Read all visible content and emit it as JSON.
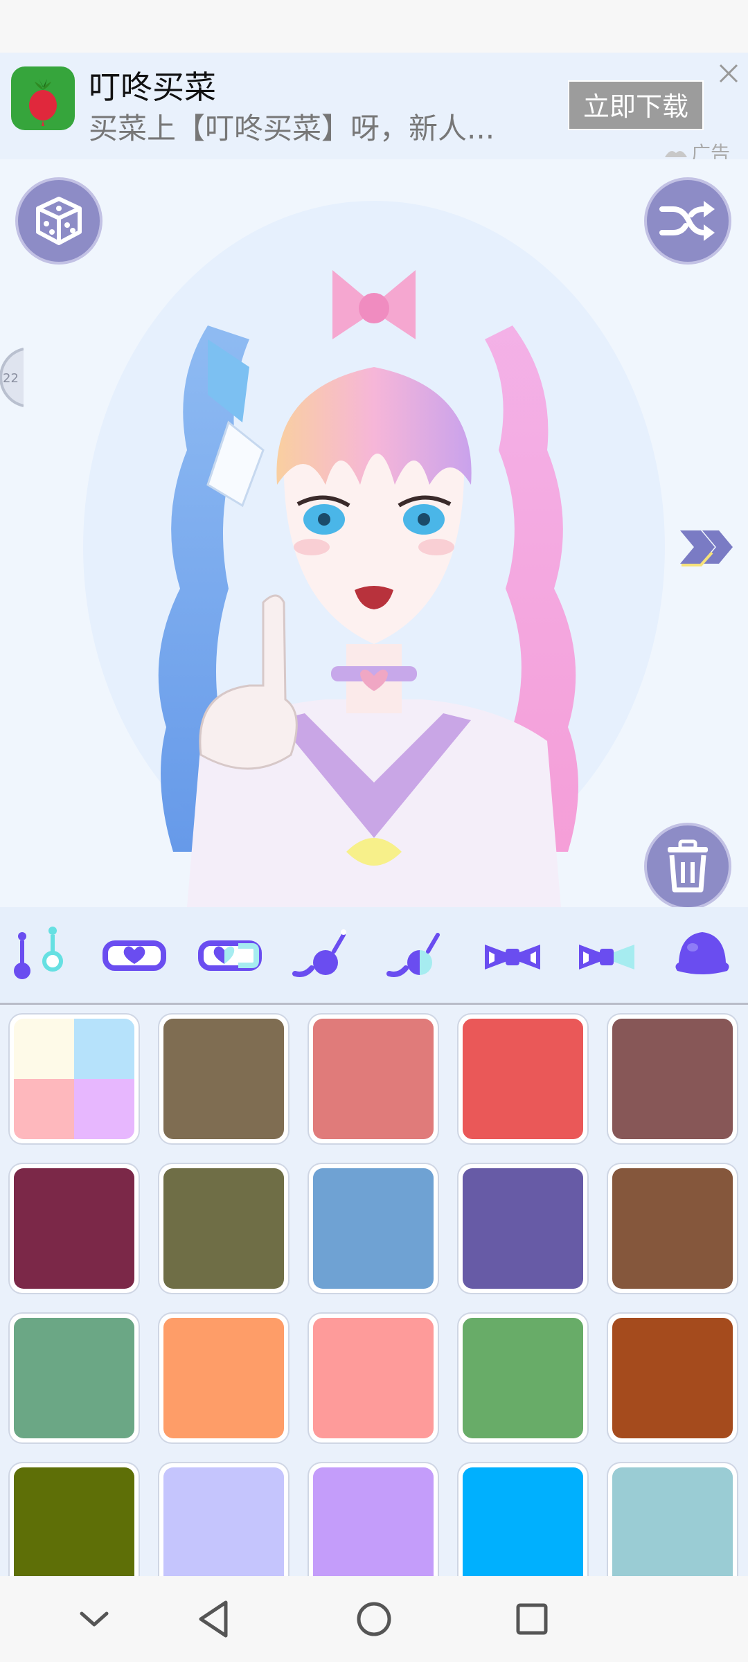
{
  "ad": {
    "app_name": "叮咚买菜",
    "description": "买菜上【叮咚买菜】呀，新人...",
    "download_label": "立即下载",
    "ad_label": "广告",
    "logo_icon": "radish-icon",
    "close_icon": "close-icon"
  },
  "canvas": {
    "level_value": "22",
    "random_icon": "dice-icon",
    "shuffle_icon": "shuffle-icon",
    "next_icon": "double-chevron-right-icon",
    "delete_icon": "trash-icon",
    "character": "anime-girl-avatar"
  },
  "categories": [
    {
      "icon": "earring-icon"
    },
    {
      "icon": "heart-clip-icon"
    },
    {
      "icon": "heart-clip-two-tone-icon"
    },
    {
      "icon": "hair-tie-icon"
    },
    {
      "icon": "hair-tie-two-tone-icon"
    },
    {
      "icon": "bow-icon"
    },
    {
      "icon": "bow-two-tone-icon"
    },
    {
      "icon": "blob-icon"
    }
  ],
  "colors": {
    "accent": "#8d8cc6",
    "icon_purple": "#6a4df0",
    "multi_swatch": [
      "#fefae8",
      "#b6e2fb",
      "#feb8bd",
      "#e7b7fe"
    ],
    "swatches": [
      "#7f6d52",
      "#e07b7a",
      "#ea5858",
      "#875757",
      "#7b2848",
      "#6f6e46",
      "#6fa2d3",
      "#675ba6",
      "#85573c",
      "#6ba785",
      "#fe9d68",
      "#fe9b9a",
      "#68ac68",
      "#a54b1d",
      "#5e6f07",
      "#c5c5fd",
      "#c49dfa",
      "#00b0fe",
      "#9accd4"
    ]
  },
  "navigation": {
    "hide_icon": "chevron-down-icon",
    "back_icon": "back-triangle-icon",
    "home_icon": "home-circle-icon",
    "recents_icon": "recents-square-icon"
  }
}
